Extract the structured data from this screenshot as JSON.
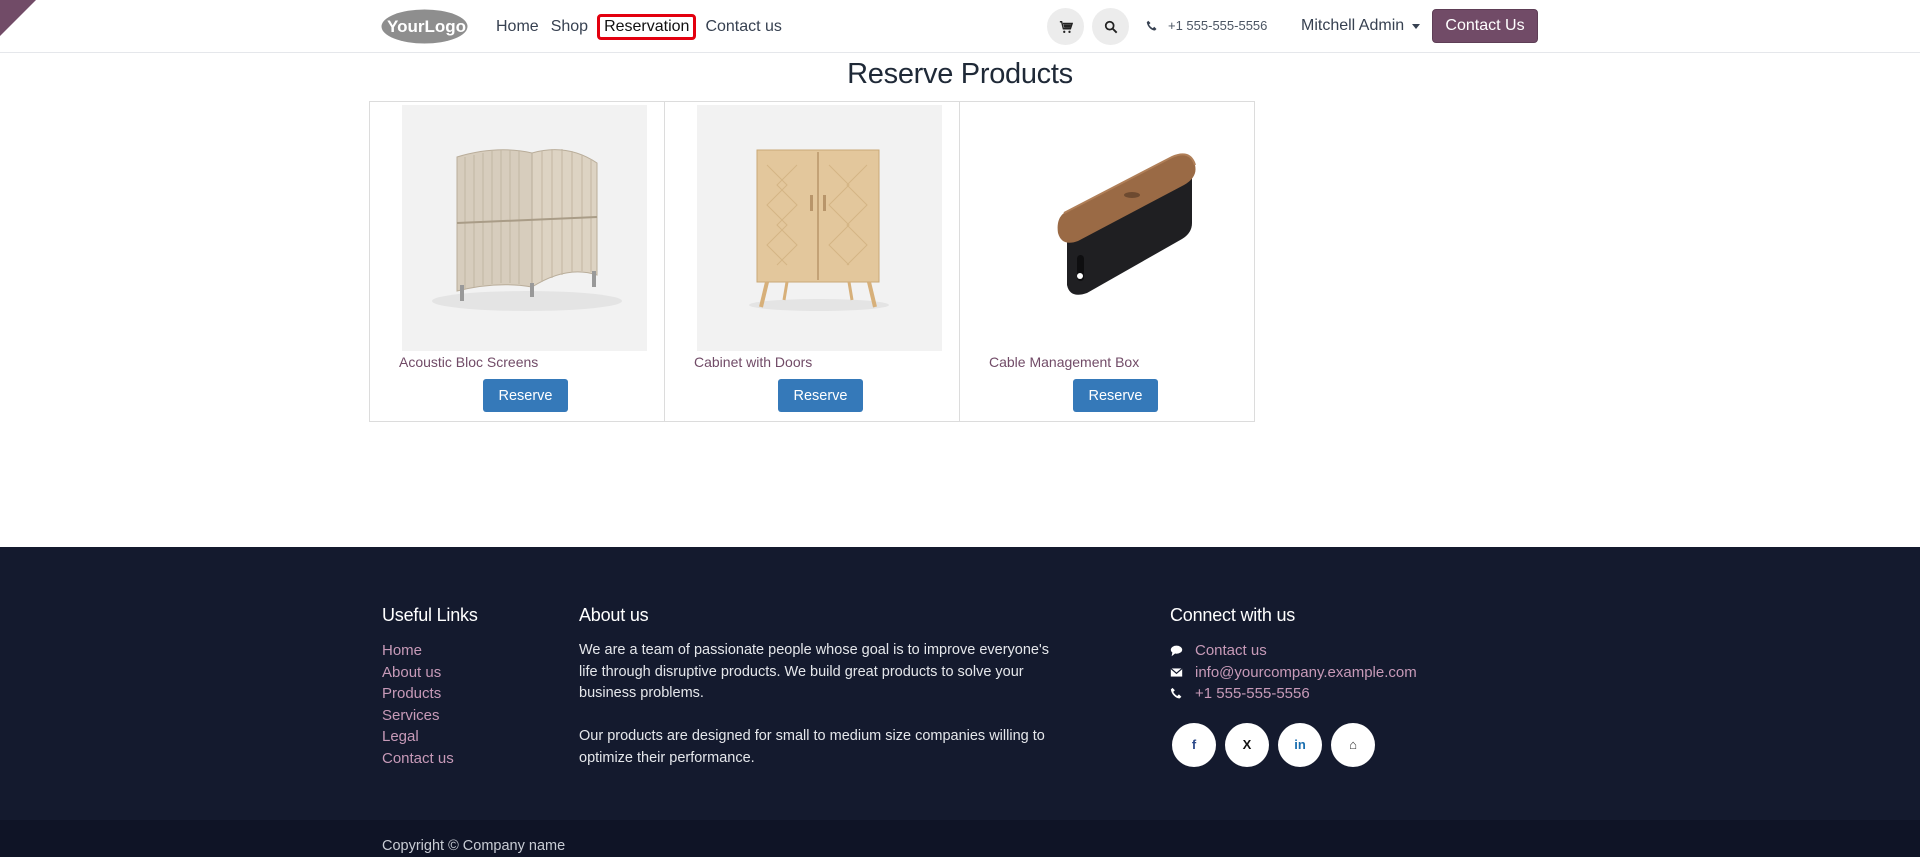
{
  "corner_badge": "⌐",
  "header": {
    "logo_text": "YourLogo",
    "nav": [
      "Home",
      "Shop",
      "Reservation",
      "Contact us"
    ],
    "active_nav": "Reservation",
    "cart_icon": "cart-icon",
    "search_icon": "search-icon",
    "phone": "+1 555-555-5556",
    "user": "Mitchell Admin",
    "cta": "Contact Us"
  },
  "main": {
    "title": "Reserve Products",
    "products": [
      {
        "name": "Acoustic Bloc Screens",
        "button": "Reserve"
      },
      {
        "name": "Cabinet with Doors",
        "button": "Reserve"
      },
      {
        "name": "Cable Management Box",
        "button": "Reserve"
      }
    ]
  },
  "footer": {
    "useful_links": {
      "title": "Useful Links",
      "items": [
        "Home",
        "About us",
        "Products",
        "Services",
        "Legal",
        "Contact us"
      ]
    },
    "about": {
      "title": "About us",
      "p1": "We are a team of passionate people whose goal is to improve everyone's life through disruptive products. We build great products to solve your business problems.",
      "p2": "Our products are designed for small to medium size companies willing to optimize their performance."
    },
    "connect": {
      "title": "Connect with us",
      "contact": "Contact us",
      "email": "info@yourcompany.example.com",
      "phone": "+1 555-555-5556",
      "socials": [
        "f",
        "X",
        "in",
        "⌂"
      ]
    },
    "copyright": "Copyright © Company name"
  },
  "colors": {
    "brand": "#714b67",
    "button_blue": "#3579b9",
    "footer_bg": "#141a2e",
    "highlight": "#e3000f"
  }
}
